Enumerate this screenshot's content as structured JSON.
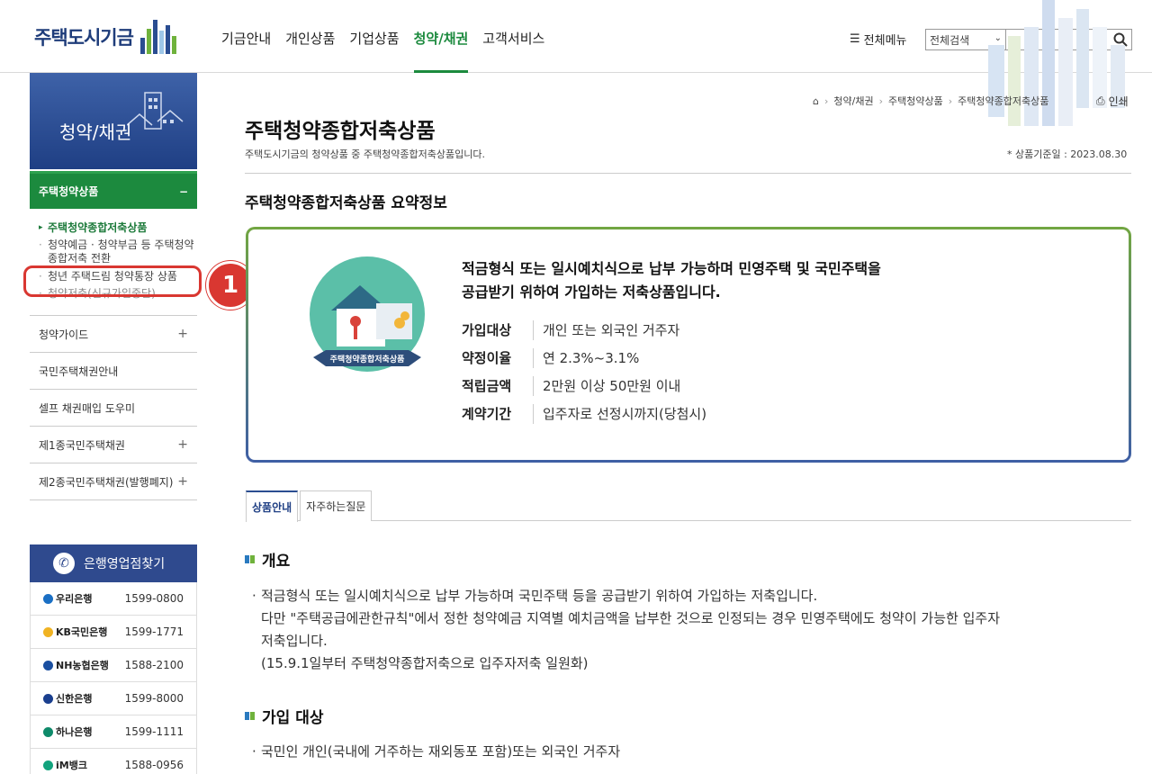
{
  "header": {
    "logo_text": "주택도시기금",
    "nav": [
      "기금안내",
      "개인상품",
      "기업상품",
      "청약/채권",
      "고객서비스"
    ],
    "active_nav": "청약/채권",
    "all_menu": "전체메뉴",
    "search_scope": "전체검색",
    "search_placeholder": ""
  },
  "sidebar": {
    "title": "청약/채권",
    "active_group": "주택청약상품",
    "active_group_toggle": "−",
    "sub_items": [
      "주택청약종합저축상품",
      "청약예금 · 청약부금 등 주택청약종합저축 전환",
      "청년 주택드림 청약통장 상품",
      "청약저축(신규가입중단)"
    ],
    "groups": [
      {
        "label": "청약가이드",
        "toggle": "+"
      },
      {
        "label": "국민주택채권안내",
        "toggle": ""
      },
      {
        "label": "셀프 채권매입 도우미",
        "toggle": ""
      },
      {
        "label": "제1종국민주택채권",
        "toggle": "+"
      },
      {
        "label": "제2종국민주택채권(발행폐지)",
        "toggle": "+"
      }
    ],
    "marker_number": "1"
  },
  "banks": {
    "title": "은행영업점찾기",
    "list": [
      {
        "name": "우리은행",
        "phone": "1599-0800",
        "color": "#1a6fc4"
      },
      {
        "name": "KB국민은행",
        "phone": "1599-1771",
        "color": "#f0b323"
      },
      {
        "name": "NH농협은행",
        "phone": "1588-2100",
        "color": "#1a4fa0"
      },
      {
        "name": "신한은행",
        "phone": "1599-8000",
        "color": "#1a3f8e"
      },
      {
        "name": "하나은행",
        "phone": "1599-1111",
        "color": "#0e8a6a"
      },
      {
        "name": "iM뱅크",
        "phone": "1588-0956",
        "color": "#12a37d"
      }
    ]
  },
  "breadcrumb": [
    "청약/채권",
    "주택청약상품",
    "주택청약종합저축상품"
  ],
  "print_label": "인쇄",
  "page": {
    "title": "주택청약종합저축상품",
    "desc": "주택도시기금의 청약상품 중 주택청약종합저축상품입니다.",
    "base_date": "* 상품기준일 : 2023.08.30",
    "summary_title": "주택청약종합저축상품 요약정보"
  },
  "summary": {
    "emblem_label": "주택청약종합저축상품",
    "headline_1": "적금형식 또는 일시예치식으로 납부 가능하며 민영주택 및 국민주택을",
    "headline_2": "공급받기 위하여 가입하는 저축상품입니다.",
    "rows": [
      {
        "label": "가입대상",
        "value": "개인 또는 외국인 거주자"
      },
      {
        "label": "약정이율",
        "value": "연 2.3%~3.1%"
      },
      {
        "label": "적립금액",
        "value": "2만원 이상 50만원 이내"
      },
      {
        "label": "계약기간",
        "value": "입주자로 선정시까지(당첨시)"
      }
    ]
  },
  "tabs": [
    "상품안내",
    "자주하는질문"
  ],
  "sections": {
    "overview_title": "개요",
    "overview_lines": [
      "적금형식 또는 일시예치식으로 납부 가능하며 국민주택 등을 공급받기 위하여 가입하는 저축입니다.",
      "다만 \"주택공급에관한규칙\"에서 정한 청약예금 지역별 예치금액을 납부한 것으로 인정되는 경우 민영주택에도 청약이 가능한 입주자",
      "저축입니다.",
      "(15.9.1일부터 주택청약종합저축으로 입주자저축 일원화)"
    ],
    "eligibility_title": "가입 대상",
    "eligibility_line": "국민인 개인(국내에 거주하는 재외동포 포함)또는 외국인 거주자"
  }
}
